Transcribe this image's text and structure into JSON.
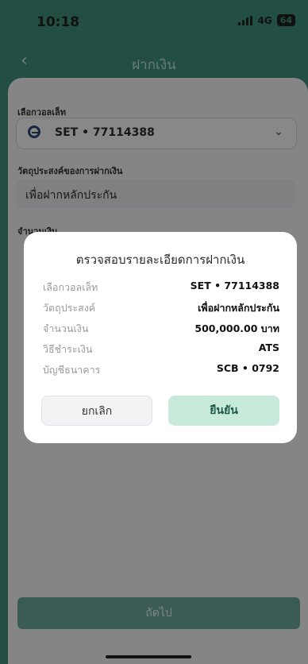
{
  "status": {
    "time": "10:18",
    "network": "4G",
    "battery": "64"
  },
  "header": {
    "title": "ฝากเงิน"
  },
  "form": {
    "wallet_label": "เลือกวอลเล็ท",
    "wallet_value": "SET • 77114388",
    "purpose_label": "วัตถุประสงค์ของการฝากเงิน",
    "purpose_value": "เพื่อฝากหลักประกัน",
    "amount_label_partial": "จำนวนเงิน"
  },
  "dialog": {
    "title": "ตรวจสอบรายละเอียดการฝากเงิน",
    "rows": [
      {
        "label": "เลือกวอลเล็ท",
        "value": "SET • 77114388"
      },
      {
        "label": "วัตถุประสงค์",
        "value": "เพื่อฝากหลักประกัน"
      },
      {
        "label": "จำนวนเงิน",
        "value": "500,000.00 บาท"
      },
      {
        "label": "วิธีชำระเงิน",
        "value": "ATS"
      },
      {
        "label": "บัญชีธนาคาร",
        "value": "SCB • 0792"
      }
    ],
    "cancel": "ยกเลิก",
    "confirm": "ยืนยัน"
  },
  "footer": {
    "next": "ถัดไป"
  },
  "icons": {
    "back": "chevron-left-icon",
    "dropdown": "chevron-down-icon",
    "wallet": "set-logo-icon"
  },
  "colors": {
    "accent": "#3f8f7a",
    "confirm_bg": "#c8eadb",
    "overlay": "rgba(0,0,0,0.45)"
  }
}
